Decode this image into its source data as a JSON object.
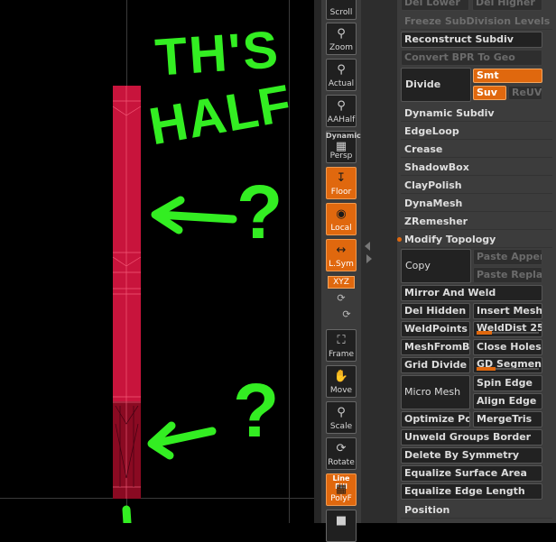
{
  "shelf": {
    "scroll": "Scroll",
    "zoom": "Zoom",
    "actual": "Actual",
    "aahalf": "AAHalf",
    "dynamic": "Dynamic",
    "persp": "Persp",
    "floor": "Floor",
    "local": "Local",
    "lsym": "L.Sym",
    "xyz": "XYZ",
    "frame": "Frame",
    "move": "Move",
    "scale": "Scale",
    "rotate": "Rotate",
    "linefill": "Line Fill",
    "polyf": "PolyF"
  },
  "panel": {
    "del_lower": "Del Lower",
    "del_higher": "Del Higher",
    "freeze_subdiv": "Freeze SubDivision Levels",
    "reconstruct_subdiv": "Reconstruct Subdiv",
    "convert_bpr": "Convert BPR To Geo",
    "divide": "Divide",
    "smt": "Smt",
    "suv": "Suv",
    "reuv": "ReUV",
    "dynamic_subdiv": "Dynamic Subdiv",
    "edgeloop": "EdgeLoop",
    "crease": "Crease",
    "shadowbox": "ShadowBox",
    "claypolish": "ClayPolish",
    "dynamesh": "DynaMesh",
    "zremesher": "ZRemesher",
    "modify_topology": "Modify Topology",
    "copy": "Copy",
    "paste_append": "Paste Append",
    "paste_replace": "Paste Replace",
    "mirror_weld": "Mirror And Weld",
    "del_hidden": "Del Hidden",
    "insert_mesh": "Insert Mesh",
    "weldpoints": "WeldPoints",
    "welddist": "WeldDist 25",
    "welddist_level": 0.25,
    "meshfrombrush": "MeshFromBrush",
    "close_holes": "Close Holes",
    "grid_divide": "Grid Divide",
    "gd_segments": "GD Segments",
    "gd_level": 0.3,
    "micro_mesh": "Micro Mesh",
    "spin_edge": "Spin Edge",
    "align_edge": "Align Edge",
    "optimize_points": "Optimize Points",
    "mergetris": "MergeTris",
    "unweld_groups": "Unweld Groups Border",
    "delete_symmetry": "Delete By Symmetry",
    "equalize_surface": "Equalize Surface Area",
    "equalize_edge": "Equalize Edge Length",
    "position": "Position"
  },
  "annotation": {
    "line1": "TH'S",
    "line2": "HALF",
    "q1": "?",
    "q2": "?",
    "color": "#33ee22"
  },
  "colors": {
    "mesh": "#c8143c",
    "accent": "#e0680e"
  }
}
